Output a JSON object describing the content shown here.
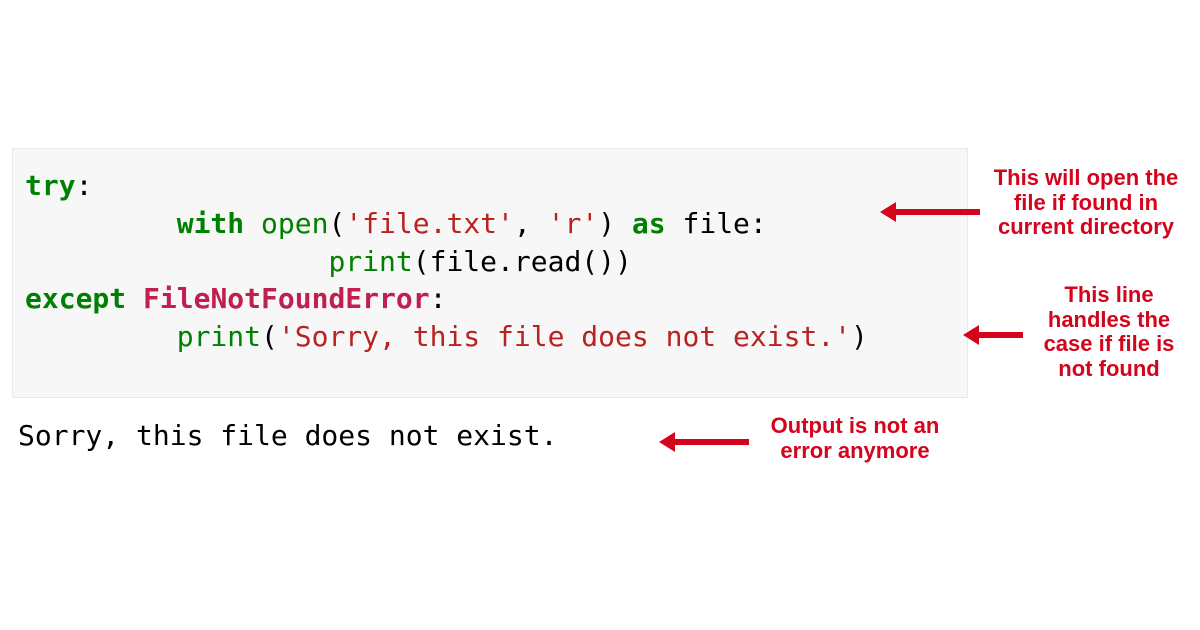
{
  "code": {
    "line1": {
      "kw": "try",
      "colon": ":"
    },
    "line2": {
      "indent": "         ",
      "with_kw": "with",
      "space1": " ",
      "open_fn": "open",
      "lparen": "(",
      "arg1": "'file.txt'",
      "comma": ", ",
      "arg2": "'r'",
      "rparen": ")",
      "space2": " ",
      "as_kw": "as",
      "space3": " ",
      "var": "file",
      "colon": ":"
    },
    "line3": {
      "indent": "                  ",
      "print_fn": "print",
      "rest": "(file.read())"
    },
    "line4": {
      "except_kw": "except",
      "space": " ",
      "exc": "FileNotFoundError",
      "colon": ":"
    },
    "line5": {
      "indent": "         ",
      "print_fn": "print",
      "lparen": "(",
      "msg": "'Sorry, this file does not exist.'",
      "rparen": ")"
    }
  },
  "output": "Sorry, this file does not exist.",
  "annotations": {
    "note1": "This will open the file if found in current directory",
    "note2": "This line handles the case if file is not found",
    "note3": "Output is not an error anymore"
  }
}
